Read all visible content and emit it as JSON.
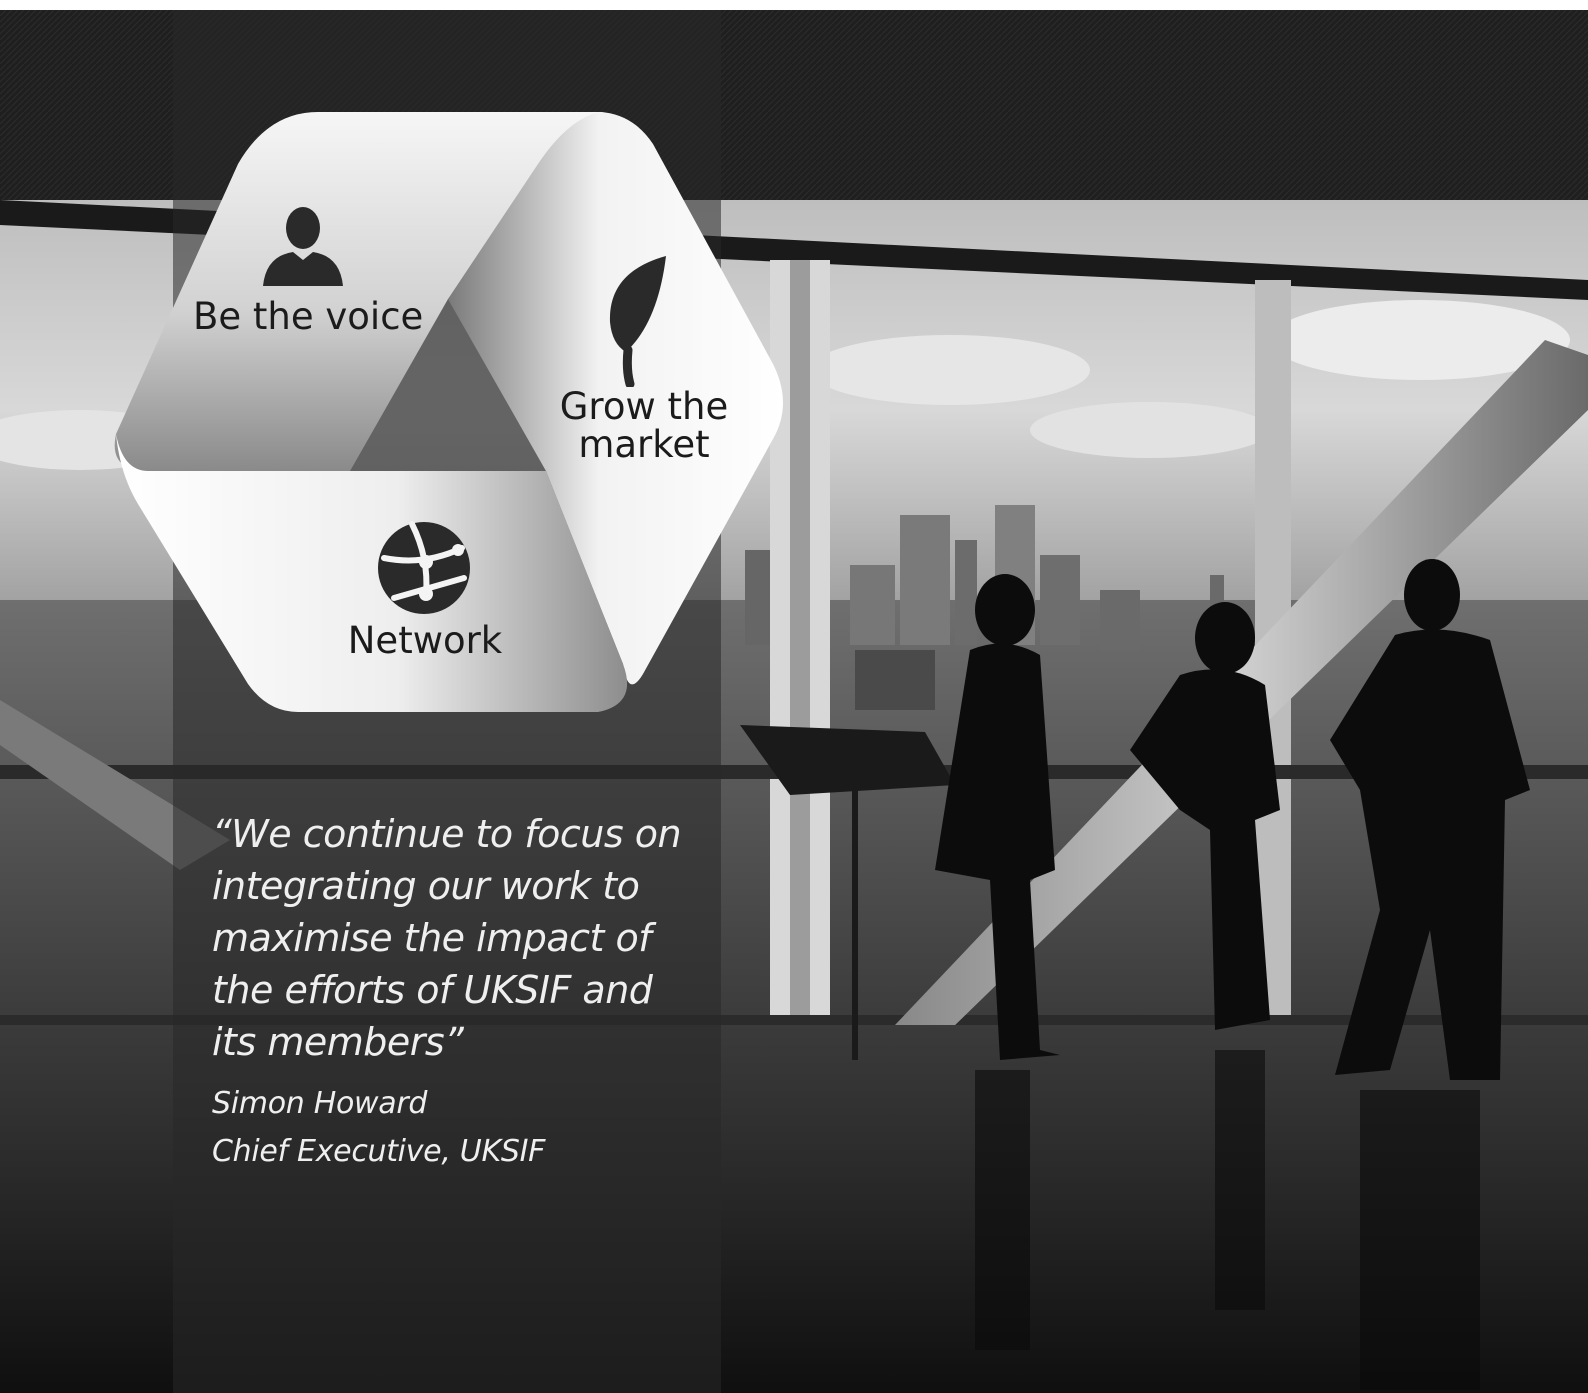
{
  "diagram": {
    "segments": [
      {
        "label": "Be the voice",
        "icon": "person-icon"
      },
      {
        "label": "Grow the\nmarket",
        "icon": "leaf-icon"
      },
      {
        "label": "Network",
        "icon": "globe-network-icon"
      }
    ]
  },
  "quote": {
    "text": "“We continue to focus on\nintegrating our work to\nmaximise the impact of\nthe efforts of UKSIF and\nits members”",
    "author": "Simon Howard",
    "role": "Chief Executive, UKSIF"
  },
  "colors": {
    "panel_overlay": "#2a2a2a",
    "segment_light": "#f5f5f5",
    "segment_dark": "#6a6a6a",
    "label_text": "#1b1b1b",
    "quote_text": "#efefef"
  }
}
